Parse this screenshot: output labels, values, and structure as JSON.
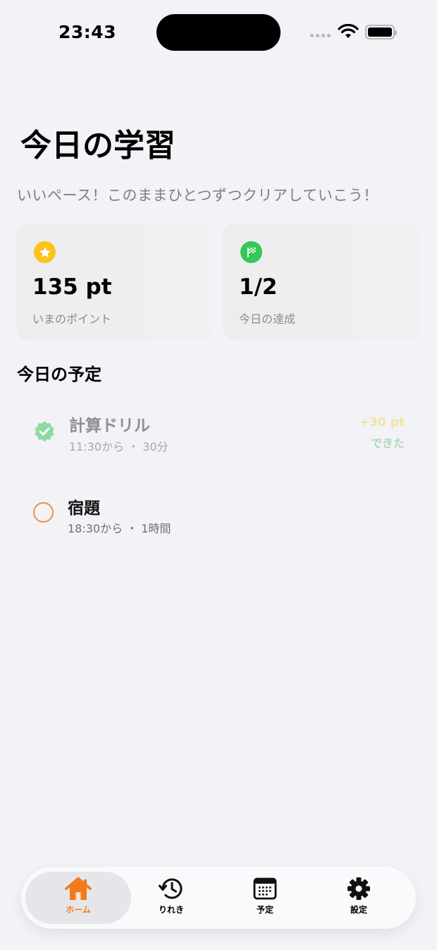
{
  "status_bar": {
    "time": "23:43"
  },
  "header": {
    "title": "今日の学習",
    "subtitle": "いいペース！このままひとつずつクリアしていこう！"
  },
  "stats": [
    {
      "icon": "star-icon",
      "value": "135 pt",
      "label": "いまのポイント",
      "color": "#FFC21A"
    },
    {
      "icon": "checkered-flag-icon",
      "value": "1/2",
      "label": "今日の達成",
      "color": "#34C759"
    }
  ],
  "schedule": {
    "title": "今日の予定",
    "items": [
      {
        "name": "計算ドリル",
        "meta": "11:30から ・ 30分",
        "points": "+30 pt",
        "status": "できた",
        "done": true
      },
      {
        "name": "宿題",
        "meta": "18:30から ・ 1時間",
        "done": false
      }
    ]
  },
  "tabs": [
    {
      "label": "ホーム",
      "icon": "house-icon",
      "active": true
    },
    {
      "label": "りれき",
      "icon": "history-icon",
      "active": false
    },
    {
      "label": "予定",
      "icon": "calendar-icon",
      "active": false
    },
    {
      "label": "設定",
      "icon": "gear-icon",
      "active": false
    }
  ],
  "colors": {
    "accent": "#F2791C",
    "background": "#F2F2F7",
    "success": "#34C759"
  }
}
